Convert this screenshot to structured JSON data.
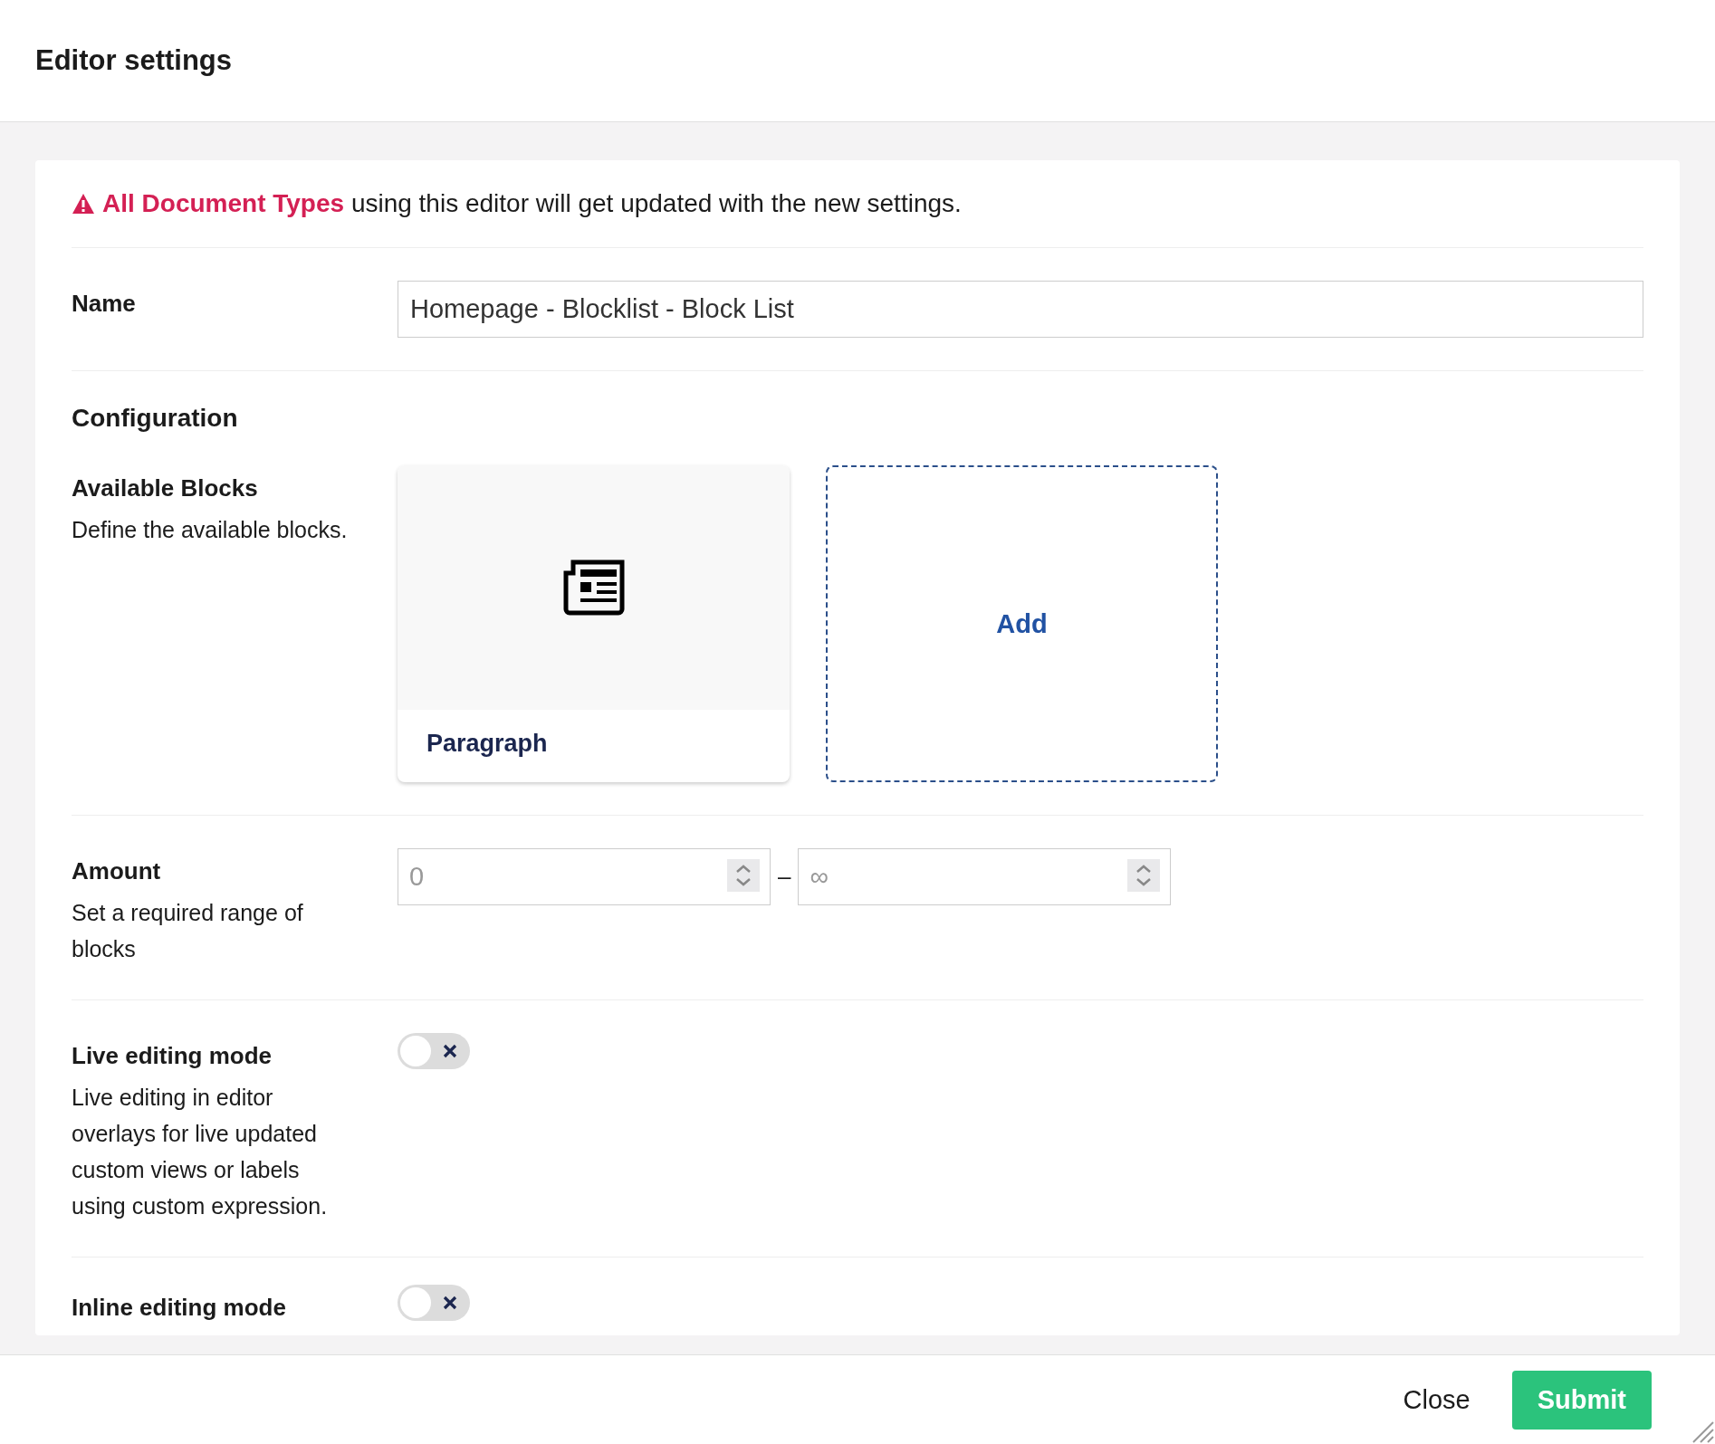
{
  "dialog": {
    "title": "Editor settings"
  },
  "notice": {
    "highlight": "All Document Types",
    "text": "using this editor will get updated with the new settings."
  },
  "fields": [
    {
      "kind": "text",
      "label": "Name",
      "value": "Homepage - Blocklist - Block List"
    },
    {
      "kind": "heading",
      "label": "Configuration"
    },
    {
      "kind": "blocks",
      "label": "Available Blocks",
      "description": "Define the available blocks.",
      "blocks": [
        {
          "name": "Paragraph"
        }
      ],
      "add_label": "Add"
    },
    {
      "kind": "range",
      "label": "Amount",
      "description": "Set a required range of blocks",
      "min_placeholder": "0",
      "separator": "–",
      "max_placeholder": "∞"
    },
    {
      "kind": "toggle",
      "label": "Live editing mode",
      "description": "Live editing in editor overlays for live updated custom views or labels using custom expression.",
      "on": false
    },
    {
      "kind": "toggle",
      "label": "Inline editing mode",
      "on": false
    }
  ],
  "footer": {
    "close": "Close",
    "submit": "Submit"
  }
}
